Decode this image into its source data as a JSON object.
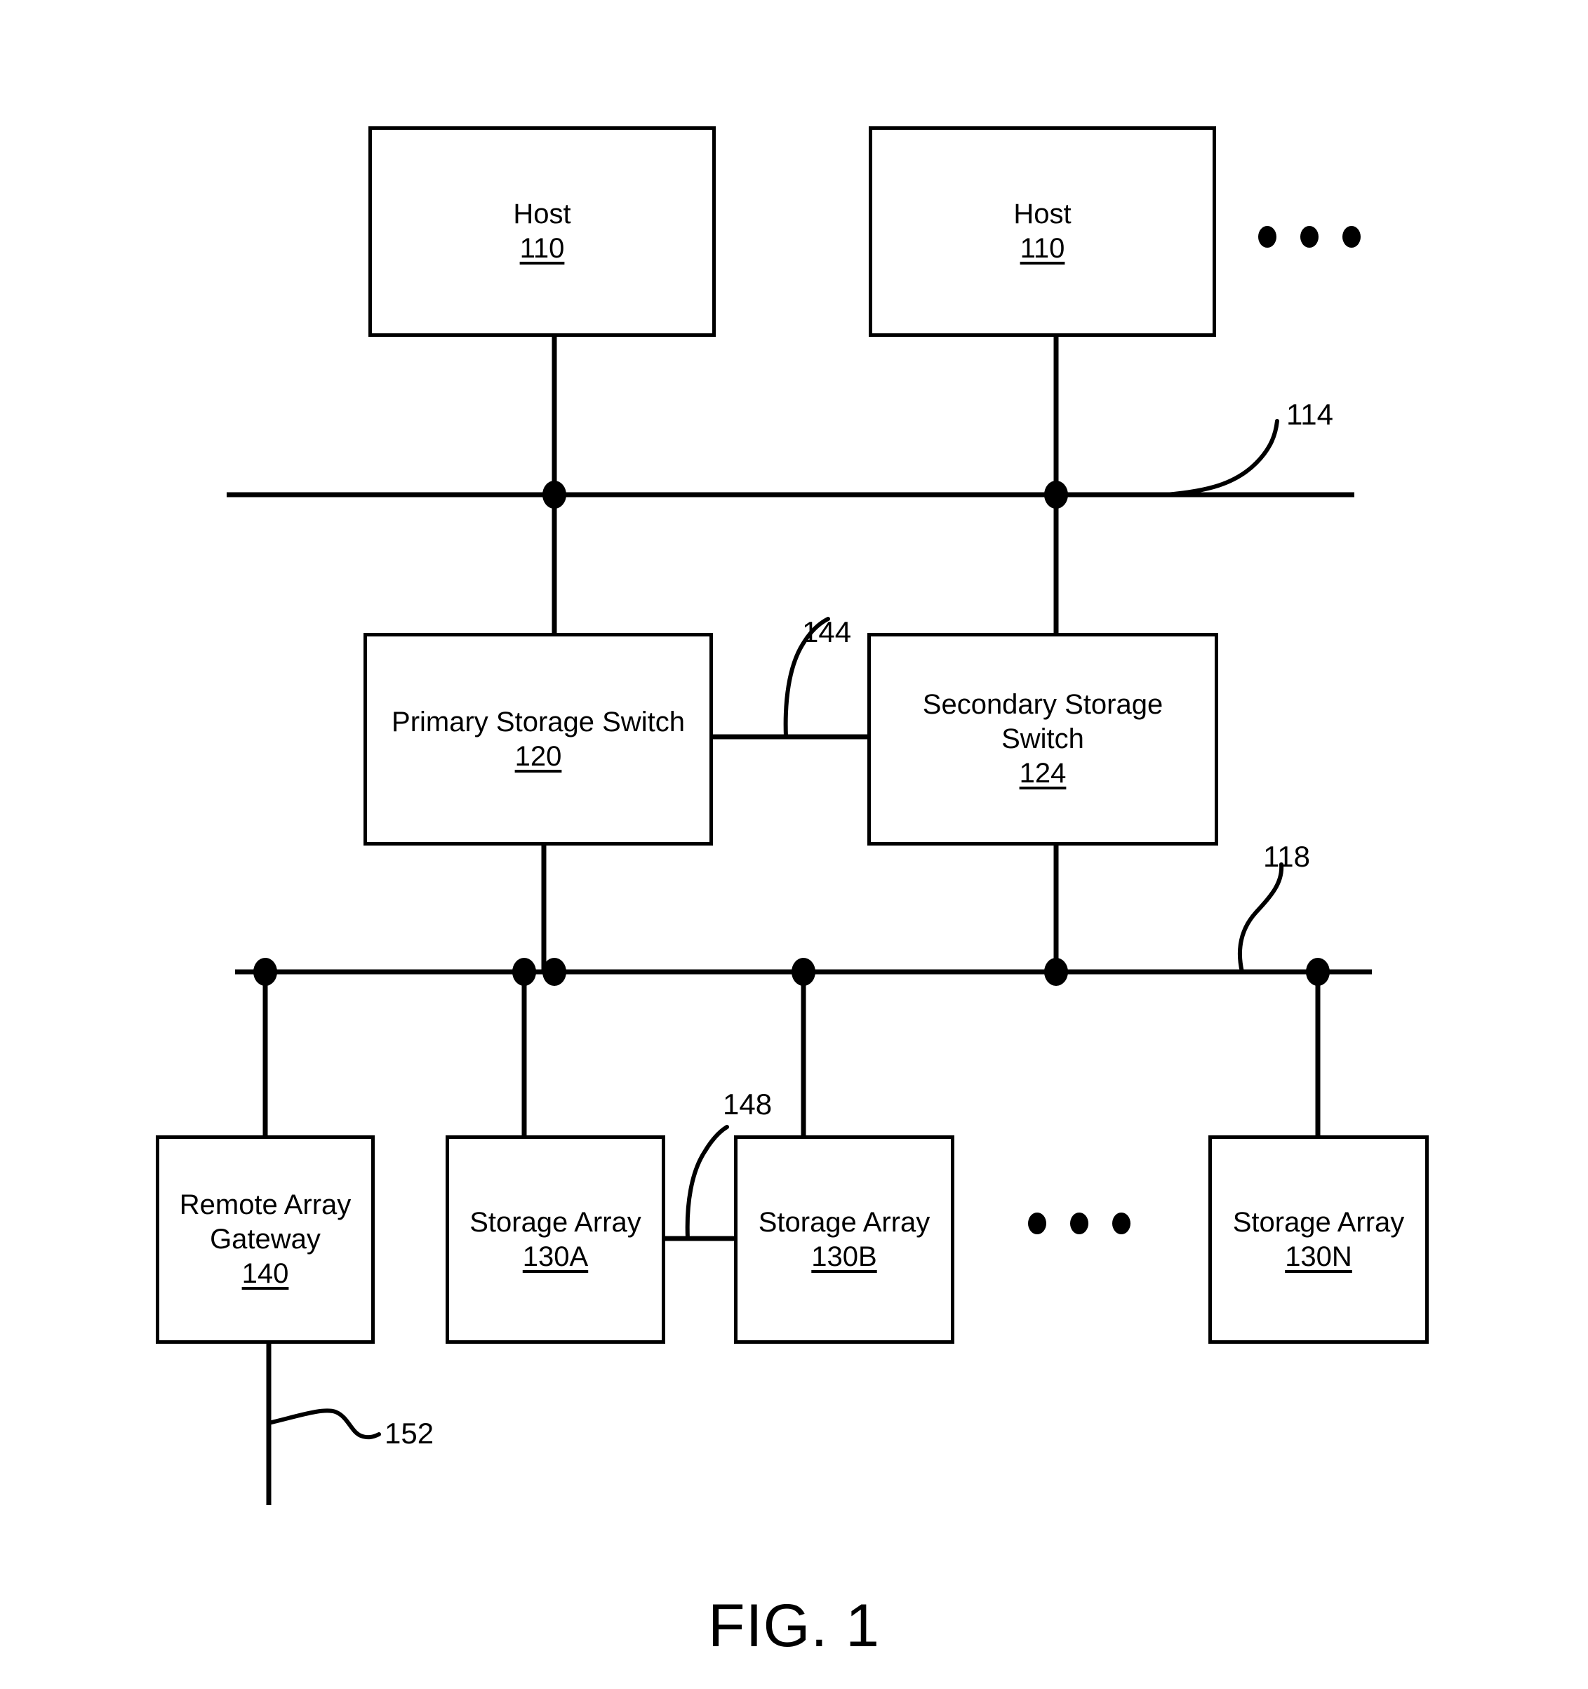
{
  "figure": {
    "caption": "FIG. 1"
  },
  "nodes": {
    "host_a": {
      "title": "Host",
      "ref": "110"
    },
    "host_b": {
      "title": "Host",
      "ref": "110"
    },
    "primary_switch": {
      "title": "Primary Storage Switch",
      "ref": "120"
    },
    "secondary_switch": {
      "title": "Secondary Storage\nSwitch",
      "ref": "124"
    },
    "remote_gateway": {
      "title": "Remote Array\nGateway",
      "ref": "140"
    },
    "storage_array_a": {
      "title": "Storage Array",
      "ref": "130A"
    },
    "storage_array_b": {
      "title": "Storage Array",
      "ref": "130B"
    },
    "storage_array_n": {
      "title": "Storage Array",
      "ref": "130N"
    }
  },
  "reference_labels": {
    "host_network": "114",
    "switch_interconnect": "144",
    "storage_network": "118",
    "array_interconnect": "148",
    "remote_link": "152"
  },
  "ellipsis": {
    "hosts": "• • •",
    "arrays": "• • •"
  },
  "colors": {
    "stroke": "#000000",
    "background": "#ffffff"
  }
}
